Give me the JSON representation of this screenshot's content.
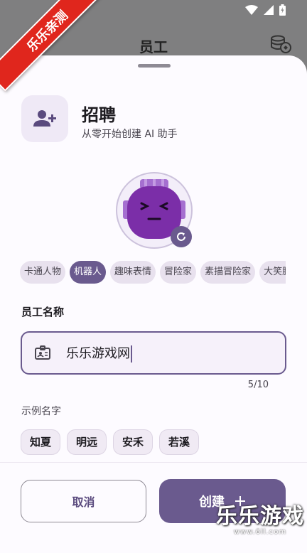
{
  "header": {
    "title": "员工"
  },
  "ribbon": {
    "text": "乐乐亲测"
  },
  "hire": {
    "title": "招聘",
    "subtitle": "从零开始创建 AI 助手"
  },
  "style_chips": [
    {
      "label": "卡通人物",
      "selected": false
    },
    {
      "label": "机器人",
      "selected": true
    },
    {
      "label": "趣味表情",
      "selected": false
    },
    {
      "label": "冒险家",
      "selected": false
    },
    {
      "label": "素描冒险家",
      "selected": false
    },
    {
      "label": "大笑脸",
      "selected": false
    }
  ],
  "name_section": {
    "label": "员工名称",
    "value": "乐乐游戏网",
    "counter": "5/10"
  },
  "examples": {
    "label": "示例名字",
    "items": [
      "知夏",
      "明远",
      "安禾",
      "若溪"
    ]
  },
  "actions": {
    "cancel": "取消",
    "create": "创建"
  },
  "watermark": {
    "text": "乐乐游戏",
    "url": "www.6ll.com"
  },
  "colors": {
    "accent": "#6a5a8e",
    "robot": "#7b2ea8",
    "ribbon": "#e0261d"
  }
}
